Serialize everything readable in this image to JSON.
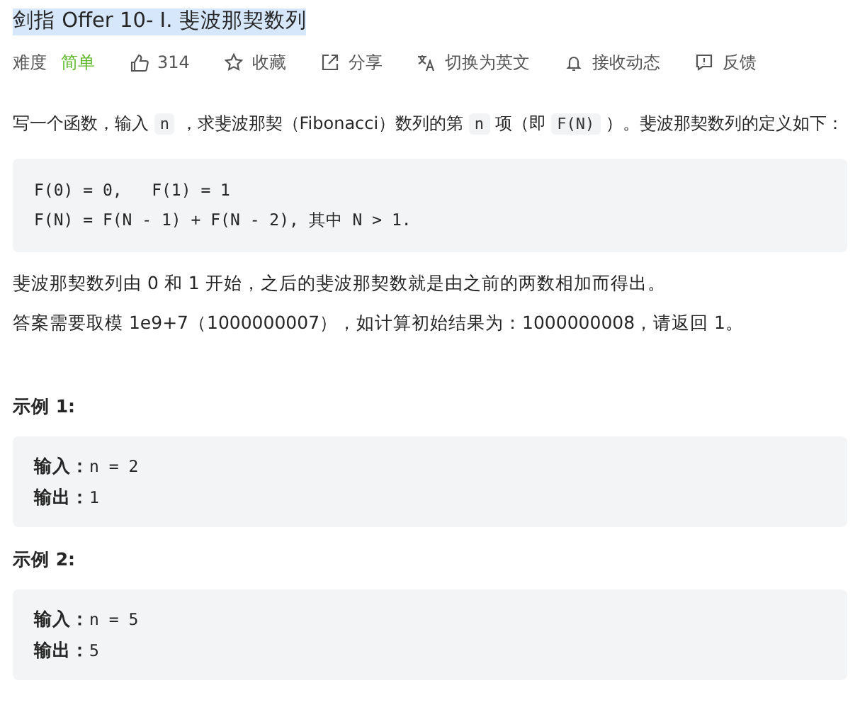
{
  "title": {
    "text": "剑指 Offer 10- I. 斐波那契数列",
    "highlighted": true
  },
  "meta": [
    {
      "kind": "label",
      "text": "难度"
    },
    {
      "kind": "difficulty",
      "text": "简单",
      "color": "#5cb82a"
    },
    {
      "kind": "like",
      "text": "314"
    },
    {
      "kind": "favorite",
      "text": "收藏"
    },
    {
      "kind": "share",
      "text": "分享"
    },
    {
      "kind": "translate",
      "text": "切换为英文"
    },
    {
      "kind": "subscribe",
      "text": "接收动态"
    },
    {
      "kind": "feedback",
      "text": "反馈"
    }
  ],
  "description": [
    {
      "kind": "text",
      "text": "写一个函数，输入 "
    },
    {
      "kind": "code",
      "text": "n"
    },
    {
      "kind": "text",
      "text": " ，求斐波那契（Fibonacci）数列的第 "
    },
    {
      "kind": "code",
      "text": "n"
    },
    {
      "kind": "text",
      "text": " 项（即 "
    },
    {
      "kind": "code",
      "text": "F(N)"
    },
    {
      "kind": "text",
      "text": " ）。斐波那契数列的定义如下："
    }
  ],
  "definition": [
    "F(0) = 0,   F(1) = 1",
    "F(N) = F(N - 1) + F(N - 2), 其中 N > 1."
  ],
  "paragraphs": [
    "斐波那契数列由 0 和 1 开始，之后的斐波那契数就是由之前的两数相加而得出。",
    "答案需要取模 1e9+7（1000000007），如计算初始结果为：1000000008，请返回 1。"
  ],
  "examples": [
    {
      "heading": "示例 1:",
      "lines": [
        {
          "label": "输入：",
          "value": "n = 2"
        },
        {
          "label": "输出：",
          "value": "1"
        }
      ]
    },
    {
      "heading": "示例 2:",
      "lines": [
        {
          "label": "输入：",
          "value": "n = 5"
        },
        {
          "label": "输出：",
          "value": "5"
        }
      ]
    }
  ]
}
